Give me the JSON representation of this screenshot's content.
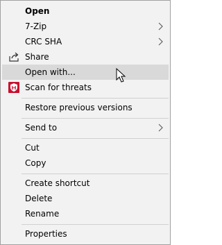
{
  "menu": {
    "items": [
      {
        "label": "Open",
        "bold": true
      },
      {
        "label": "7-Zip",
        "submenu": true
      },
      {
        "label": "CRC SHA",
        "submenu": true
      },
      {
        "label": "Share",
        "icon": "share-icon"
      },
      {
        "label": "Open with...",
        "hovered": true
      },
      {
        "label": "Scan for threats",
        "icon": "mcafee-shield-icon"
      },
      {
        "label": "Restore previous versions"
      },
      {
        "label": "Send to",
        "submenu": true
      },
      {
        "label": "Cut"
      },
      {
        "label": "Copy"
      },
      {
        "label": "Create shortcut"
      },
      {
        "label": "Delete"
      },
      {
        "label": "Rename"
      },
      {
        "label": "Properties"
      }
    ]
  },
  "colors": {
    "menu_background": "#f2f2f2",
    "hover_background": "#d9d9d9",
    "separator": "#d0d0d0",
    "mcafee_red": "#c8102e"
  }
}
